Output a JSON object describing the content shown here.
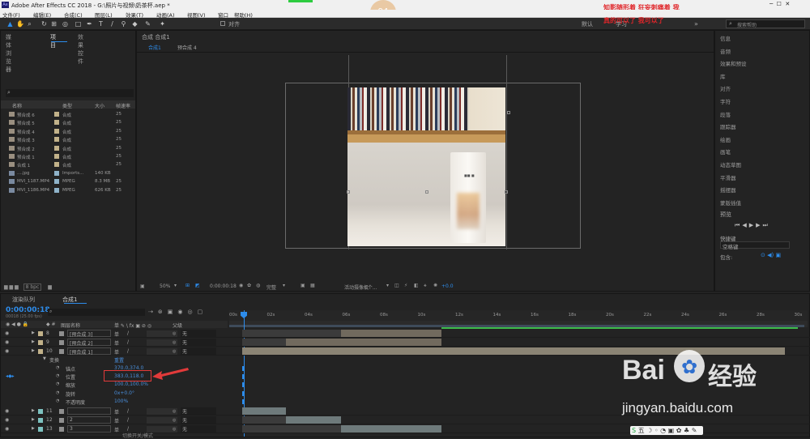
{
  "window": {
    "title": "Adobe After Effects CC 2018 - G:\\照片与视频\\奶茶杯.aep *",
    "overlay_top": "知影随形着 狂妄刺痛着 我",
    "overlay_bottom": "真的可以了 我可以了",
    "badge": "94"
  },
  "menu": [
    "文件(F)",
    "编辑(E)",
    "合成(C)",
    "图层(L)",
    "效果(T)",
    "动画(A)",
    "视图(V)",
    "窗口",
    "帮助(H)"
  ],
  "toolbar": {
    "align_label": "对齐",
    "workspace_default": "默认",
    "workspace_learn": "学习",
    "search_placeholder": "搜索帮助"
  },
  "project_panel": {
    "tabs": [
      "媒体浏览器",
      "项目",
      "效果控件"
    ],
    "columns": [
      "名称",
      "类型",
      "大小",
      "帧速率"
    ],
    "items": [
      {
        "name": "预合成 6",
        "type": "合成",
        "size": "",
        "fps": "25"
      },
      {
        "name": "预合成 5",
        "type": "合成",
        "size": "",
        "fps": "25"
      },
      {
        "name": "预合成 4",
        "type": "合成",
        "size": "",
        "fps": "25"
      },
      {
        "name": "预合成 3",
        "type": "合成",
        "size": "",
        "fps": "25"
      },
      {
        "name": "预合成 2",
        "type": "合成",
        "size": "",
        "fps": "25"
      },
      {
        "name": "预合成 1",
        "type": "合成",
        "size": "",
        "fps": "25"
      },
      {
        "name": "合成 1",
        "type": "合成",
        "size": "",
        "fps": "25"
      },
      {
        "name": "....jpg",
        "type": "Imports...",
        "size": "140 KB",
        "fps": ""
      },
      {
        "name": "MVI_1187.MP4",
        "type": "MPEG",
        "size": "8.3 MB",
        "fps": "25"
      },
      {
        "name": "MVI_1186.MP4",
        "type": "MPEG",
        "size": "626 KB",
        "fps": "25"
      }
    ],
    "bpc": "8 bpc"
  },
  "comp_panel": {
    "tab": "合成 合成1",
    "breadcrumbs": [
      "合成1",
      "预合成 4"
    ],
    "footer": {
      "zoom": "50%",
      "time": "0:00:00:18",
      "quality": "完整",
      "camera": "活动摄像机",
      "views": "1个...",
      "exposure": "+0.0"
    }
  },
  "right_panel": {
    "items": [
      "信息",
      "音频",
      "效果和预设",
      "库",
      "对齐",
      "字符",
      "段落",
      "跟踪器",
      "绘画",
      "画笔",
      "动态草图",
      "平滑器",
      "摇摆器",
      "蒙版插值"
    ],
    "preview_title": "预览",
    "shortcut_label": "快捷键",
    "shortcut_value": "空格键",
    "include_label": "包含:"
  },
  "timeline": {
    "tabs": [
      "渲染队列",
      "合成1"
    ],
    "timecode": "0:00:00:18",
    "timecode_sub": "00018 (25.00 fps)",
    "columns": {
      "source": "图层名称",
      "parent": "父级"
    },
    "ticks": [
      "00s",
      "02s",
      "04s",
      "06s",
      "08s",
      "10s",
      "12s",
      "14s",
      "16s",
      "18s",
      "20s",
      "22s",
      "24s",
      "26s",
      "28s",
      "30s"
    ],
    "layers": [
      {
        "num": "8",
        "name": "[预合成 3]",
        "parent": "无"
      },
      {
        "num": "9",
        "name": "[预合成 2]",
        "parent": "无"
      },
      {
        "num": "10",
        "name": "[预合成 1]",
        "parent": "无"
      }
    ],
    "transform_label": "变换",
    "reset_label": "重置",
    "props": [
      {
        "name": "锚点",
        "value": "370.0,374.0"
      },
      {
        "name": "位置",
        "value": "383.0,118.0"
      },
      {
        "name": "缩放",
        "value": "100.0,100.0%"
      },
      {
        "name": "旋转",
        "value": "0x+0.0°"
      },
      {
        "name": "不透明度",
        "value": "100%"
      }
    ],
    "lower_layers": [
      {
        "num": "11",
        "name": "",
        "parent": "无"
      },
      {
        "num": "12",
        "name": "2",
        "parent": "无"
      },
      {
        "num": "13",
        "name": "3",
        "parent": "无"
      }
    ],
    "footer": "切换开关/模式"
  },
  "watermark": {
    "brand": "Bai",
    "brand2": "经验",
    "url": "jingyan.baidu.com"
  },
  "colors": {
    "accent": "#2d8ceb",
    "highlight": "#e23a3a",
    "bg": "#232323"
  }
}
